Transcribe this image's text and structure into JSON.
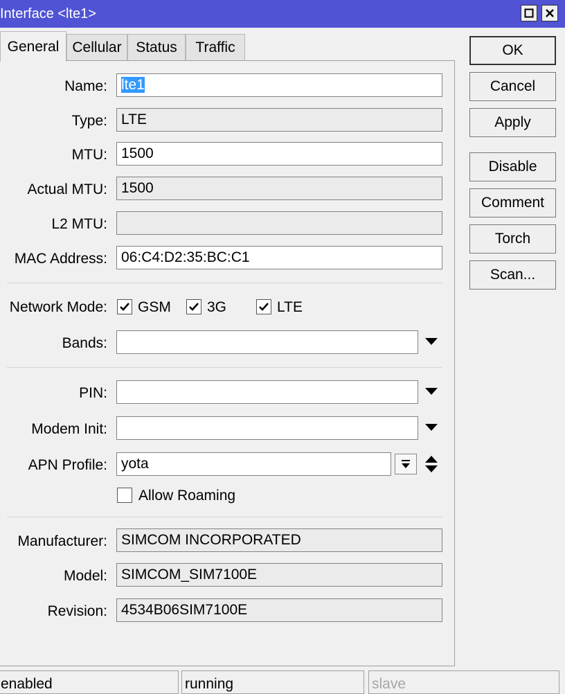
{
  "window": {
    "title": "Interface <lte1>"
  },
  "tabs": [
    {
      "label": "General"
    },
    {
      "label": "Cellular"
    },
    {
      "label": "Status"
    },
    {
      "label": "Traffic"
    }
  ],
  "general": {
    "name": {
      "label": "Name:",
      "value": "lte1"
    },
    "type": {
      "label": "Type:",
      "value": "LTE"
    },
    "mtu": {
      "label": "MTU:",
      "value": "1500"
    },
    "actual_mtu": {
      "label": "Actual MTU:",
      "value": "1500"
    },
    "l2_mtu": {
      "label": "L2 MTU:",
      "value": ""
    },
    "mac_address": {
      "label": "MAC Address:",
      "value": "06:C4:D2:35:BC:C1"
    },
    "network_mode": {
      "label": "Network Mode:",
      "options": [
        {
          "label": "GSM",
          "checked": true
        },
        {
          "label": "3G",
          "checked": true
        },
        {
          "label": "LTE",
          "checked": true
        }
      ]
    },
    "bands": {
      "label": "Bands:",
      "value": ""
    },
    "pin": {
      "label": "PIN:",
      "value": ""
    },
    "modem_init": {
      "label": "Modem Init:",
      "value": ""
    },
    "apn_profile": {
      "label": "APN Profile:",
      "value": "yota"
    },
    "allow_roaming": {
      "label": "Allow Roaming",
      "checked": false
    },
    "manufacturer": {
      "label": "Manufacturer:",
      "value": "SIMCOM INCORPORATED"
    },
    "model": {
      "label": "Model:",
      "value": "SIMCOM_SIM7100E"
    },
    "revision": {
      "label": "Revision:",
      "value": "4534B06SIM7100E"
    }
  },
  "buttons": {
    "ok": "OK",
    "cancel": "Cancel",
    "apply": "Apply",
    "disable": "Disable",
    "comment": "Comment",
    "torch": "Torch",
    "scan": "Scan..."
  },
  "statusbar": [
    "enabled",
    "running",
    "slave"
  ],
  "icons": {
    "maximize": "maximize-icon",
    "close": "close-icon",
    "checkmark": "checkmark-icon",
    "dropdown": "dropdown-arrow-icon",
    "list": "list-dropdown-icon",
    "updown": "up-down-arrow-icon"
  },
  "colors": {
    "titlebar": "#4f53d4",
    "selection": "#3399ff",
    "window_bg": "#f0f0f0"
  }
}
